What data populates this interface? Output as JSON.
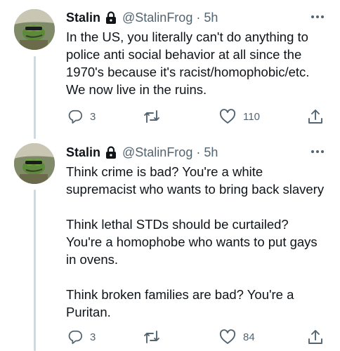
{
  "tweets": [
    {
      "name": "Stalin",
      "handle": "@StalinFrog",
      "separator": "·",
      "time": "5h",
      "paragraphs": [
        "In the US, you literally can't do anything to police anti social behavior at all since the 1970's because it's racist/homophobic/etc. We now live in the ruins."
      ],
      "replies": "3",
      "retweets": "",
      "likes": "110"
    },
    {
      "name": "Stalin",
      "handle": "@StalinFrog",
      "separator": "·",
      "time": "5h",
      "paragraphs": [
        "Think crime is bad? You're a white supremacist who wants to bring back slavery",
        "Think lethal STDs should be curtailed? You're a homophobe who wants to put gays in ovens.",
        "Think broken families are bad? You're a Puritan."
      ],
      "replies": "3",
      "retweets": "",
      "likes": "84"
    }
  ],
  "icons": {
    "lock": "lock-icon",
    "more": "more-icon",
    "reply": "reply-icon",
    "retweet": "retweet-icon",
    "like": "heart-icon",
    "share": "share-icon"
  },
  "colors": {
    "text": "#0f1419",
    "secondary": "#536471",
    "thread_line": "#cfd9de"
  }
}
